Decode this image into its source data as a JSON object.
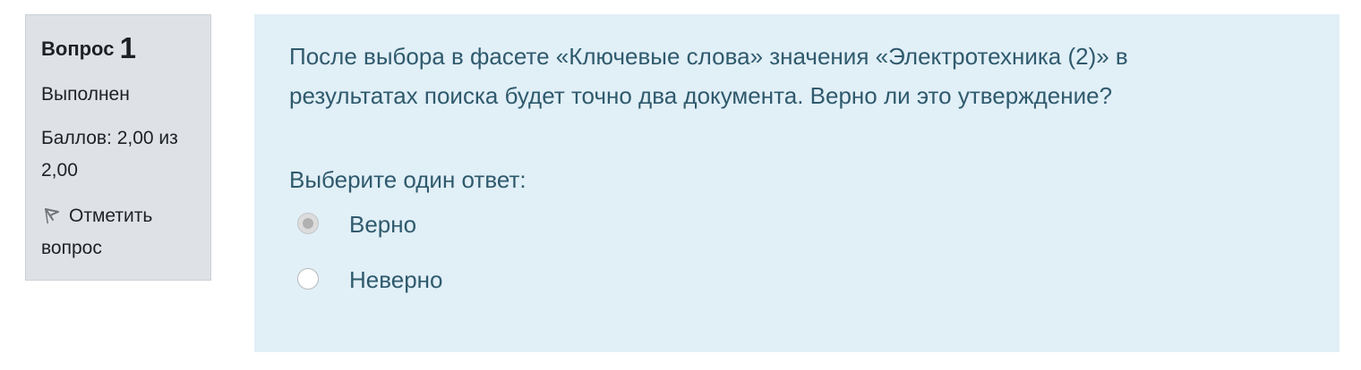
{
  "info": {
    "question_label": "Вопрос",
    "question_number": "1",
    "state": "Выполнен",
    "grade_line1": "Баллов: 2,00 из",
    "grade_line2": "2,00",
    "flag_line1": "Отметить",
    "flag_line2": "вопрос",
    "flag_icon": "flag-icon"
  },
  "question": {
    "text_line1": "После выбора в фасете «Ключевые слова» значения «Электротехника (2)» в",
    "text_line2": "результатах поиска будет точно два документа. Верно ли это утверждение?",
    "prompt": "Выберите один ответ:",
    "answers": [
      {
        "label": "Верно",
        "selected": true
      },
      {
        "label": "Неверно",
        "selected": false
      }
    ]
  },
  "colors": {
    "info_bg": "#dee2e6",
    "content_bg": "#e1eff7",
    "question_text": "#2f5a6d"
  }
}
